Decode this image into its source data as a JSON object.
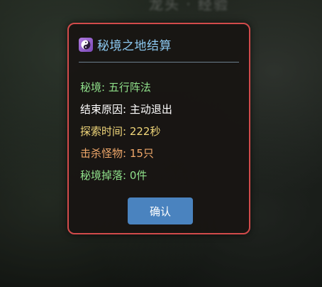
{
  "background": {
    "title_fragment": "龙头 · 经验"
  },
  "dialog": {
    "icon": "yin-yang-icon",
    "title": "秘境之地结算",
    "lines": [
      {
        "text": "秘境: 五行阵法",
        "color": "#8fe08a"
      },
      {
        "text": "结束原因: 主动退出",
        "color": "#ffffff"
      },
      {
        "text": "探索时间: 222秒",
        "color": "#f0d67a"
      },
      {
        "text": "击杀怪物: 15只",
        "color": "#f0a86a"
      },
      {
        "text": "秘境掉落: 0件",
        "color": "#8fe08a"
      }
    ],
    "confirm_label": "确认"
  },
  "colors": {
    "border": "#d24b4b",
    "title": "#8cc8f0",
    "button": "#4a83bf"
  }
}
